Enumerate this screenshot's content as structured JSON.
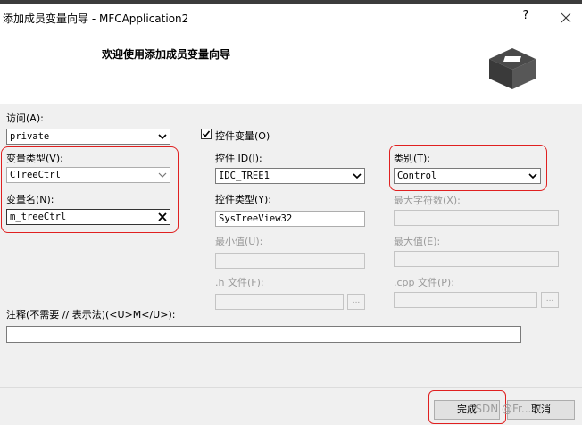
{
  "window": {
    "title": "添加成员变量向导 - MFCApplication2",
    "help_label": "?"
  },
  "header": {
    "heading": "欢迎使用添加成员变量向导"
  },
  "access": {
    "label": "访问(A):",
    "value": "private"
  },
  "control_variable": {
    "label": "控件变量(O)",
    "checked": true
  },
  "variable_type": {
    "label": "变量类型(V):",
    "value": "CTreeCtrl"
  },
  "variable_name": {
    "label": "变量名(N):",
    "value": "m_treeCtrl"
  },
  "control_id": {
    "label": "控件 ID(I):",
    "value": "IDC_TREE1"
  },
  "control_type": {
    "label": "控件类型(Y):",
    "value": "SysTreeView32"
  },
  "category": {
    "label": "类别(T):",
    "value": "Control"
  },
  "max_chars": {
    "label": "最大字符数(X):"
  },
  "min_value": {
    "label": "最小值(U):"
  },
  "max_value": {
    "label": "最大值(E):"
  },
  "h_file": {
    "label": ".h 文件(F):",
    "browse_label": "..."
  },
  "cpp_file": {
    "label": ".cpp 文件(P):",
    "browse_label": "..."
  },
  "comment": {
    "label": "注释(不需要 // 表示法)(<U>M</U>):",
    "value": ""
  },
  "buttons": {
    "finish": "完成",
    "cancel": "取消"
  },
  "watermark": "CSDN @Fr...-7",
  "colors": {
    "highlight": "#e02020",
    "dialog_bg": "#f0f0f0"
  }
}
